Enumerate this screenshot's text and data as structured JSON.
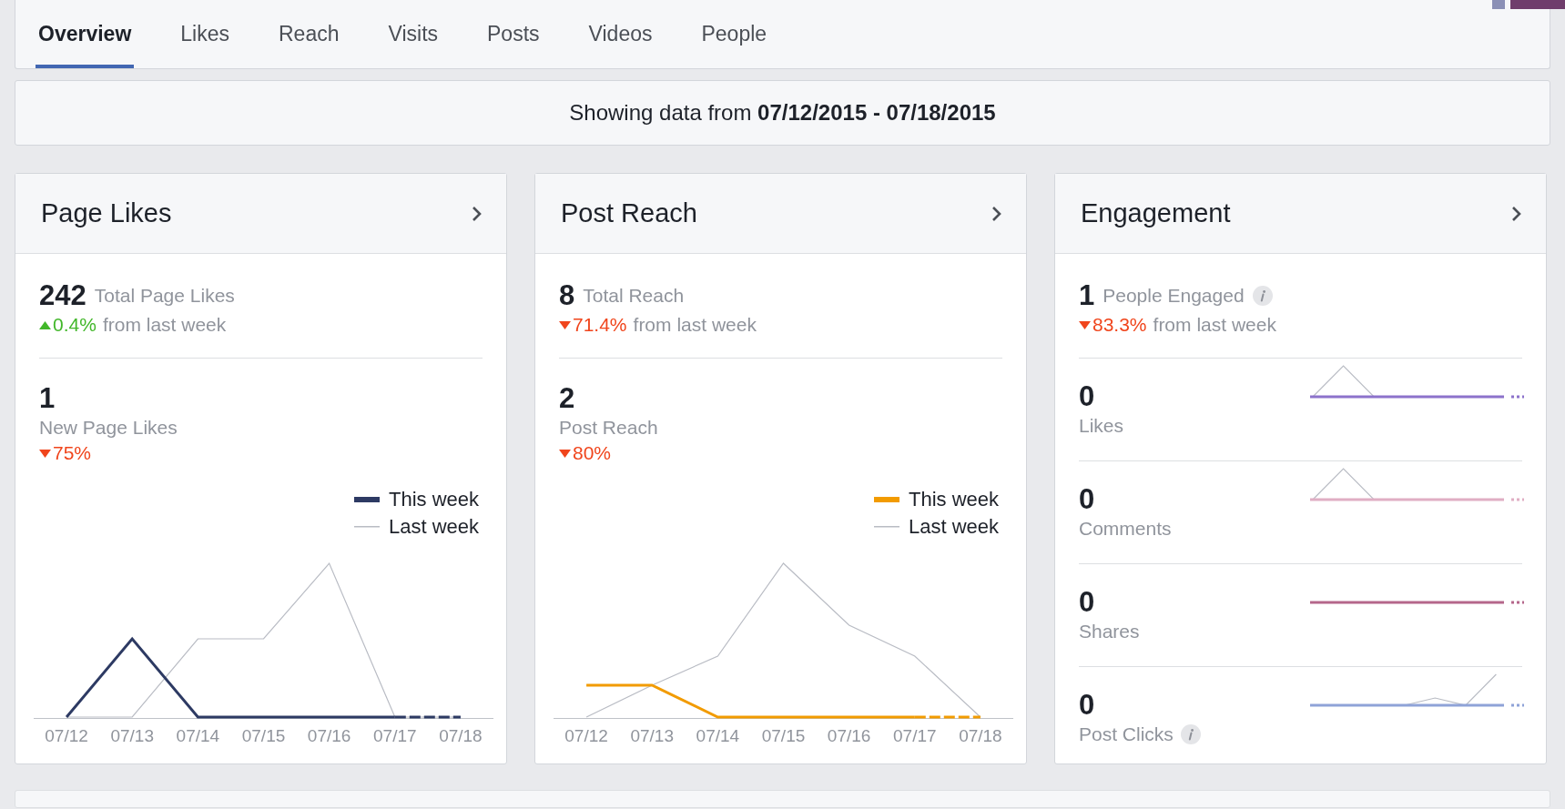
{
  "tabs": [
    {
      "label": "Overview",
      "selected": true
    },
    {
      "label": "Likes",
      "selected": false
    },
    {
      "label": "Reach",
      "selected": false
    },
    {
      "label": "Visits",
      "selected": false
    },
    {
      "label": "Posts",
      "selected": false
    },
    {
      "label": "Videos",
      "selected": false
    },
    {
      "label": "People",
      "selected": false
    }
  ],
  "date_range": "Showing data from **07/12/2015 - 07/18/2015**",
  "cards": [
    {
      "kind": "trend",
      "title": "Page Likes",
      "total": {
        "value": "242",
        "label": "Total Page Likes",
        "change": "0.4%",
        "up": true,
        "suffix": "from last week"
      },
      "period": {
        "value": "1",
        "label": "New Page Likes",
        "change": "75%",
        "up": false
      },
      "legend": [
        {
          "label": "This week",
          "color": "#2d3a63"
        },
        {
          "label": "Last week",
          "color": "#b9bcc4"
        }
      ],
      "x_labels": [
        "07/12",
        "07/13",
        "07/14",
        "07/15",
        "07/16",
        "07/17",
        "07/18"
      ]
    },
    {
      "kind": "trend",
      "title": "Post Reach",
      "total": {
        "value": "8",
        "label": "Total Reach",
        "change": "71.4%",
        "up": false,
        "suffix": "from last week"
      },
      "period": {
        "value": "2",
        "label": "Post Reach",
        "change": "80%",
        "up": false
      },
      "legend": [
        {
          "label": "This week",
          "color": "#f29b00"
        },
        {
          "label": "Last week",
          "color": "#b9bcc4"
        }
      ],
      "x_labels": [
        "07/12",
        "07/13",
        "07/14",
        "07/15",
        "07/16",
        "07/17",
        "07/18"
      ]
    },
    {
      "kind": "breakdown",
      "title": "Engagement",
      "total": {
        "value": "1",
        "label": "People Engaged",
        "info": true,
        "change": "83.3%",
        "up": false,
        "suffix": "from last week"
      },
      "metrics": [
        {
          "value": "0",
          "label": "Likes",
          "color": "#8c72cb",
          "info": false
        },
        {
          "value": "0",
          "label": "Comments",
          "color": "#e0aec4",
          "info": false
        },
        {
          "value": "0",
          "label": "Shares",
          "color": "#b5678b",
          "info": false
        },
        {
          "value": "0",
          "label": "Post Clicks",
          "color": "#8fa3d8",
          "info": true
        }
      ]
    }
  ]
}
